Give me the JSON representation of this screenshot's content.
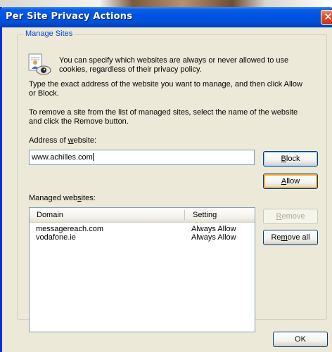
{
  "window": {
    "title": "Per Site Privacy Actions",
    "close_symbol": "✕"
  },
  "manage_sites": {
    "group_label": "Manage Sites",
    "intro_text_line1": "You can specify which websites are always or never allowed to use",
    "intro_text_line2": "cookies, regardless of their privacy policy.",
    "instruction_line1": "Type the exact address of the website you want to manage, and then click Allow",
    "instruction_line2": "or Block.",
    "remove_instruction_line1": "To remove a site from the list of managed sites, select the name of the website",
    "remove_instruction_line2": "and click the Remove button.",
    "address_label_prefix": "Address of ",
    "address_label_mnemonic": "w",
    "address_label_suffix": "ebsite:",
    "address_value": "www.achilles.com",
    "managed_label_prefix": "Managed web",
    "managed_label_mnemonic": "s",
    "managed_label_suffix": "ites:",
    "columns": [
      "Domain",
      "Setting"
    ],
    "rows": [
      {
        "domain": "messagereach.com",
        "setting": "Always Allow"
      },
      {
        "domain": "vodafone.ie",
        "setting": "Always Allow"
      }
    ]
  },
  "buttons": {
    "block_mnemonic": "B",
    "block_rest": "lock",
    "allow_mnemonic": "A",
    "allow_rest": "llow",
    "remove_mnemonic": "R",
    "remove_rest": "emove",
    "remove_all_prefix": "Re",
    "remove_all_mnemonic": "m",
    "remove_all_suffix": "ove all",
    "ok": "OK"
  },
  "colors": {
    "accent": "#0046d5",
    "title_bar": "#0054e3",
    "face": "#ece9d8",
    "close": "#d9532d"
  }
}
